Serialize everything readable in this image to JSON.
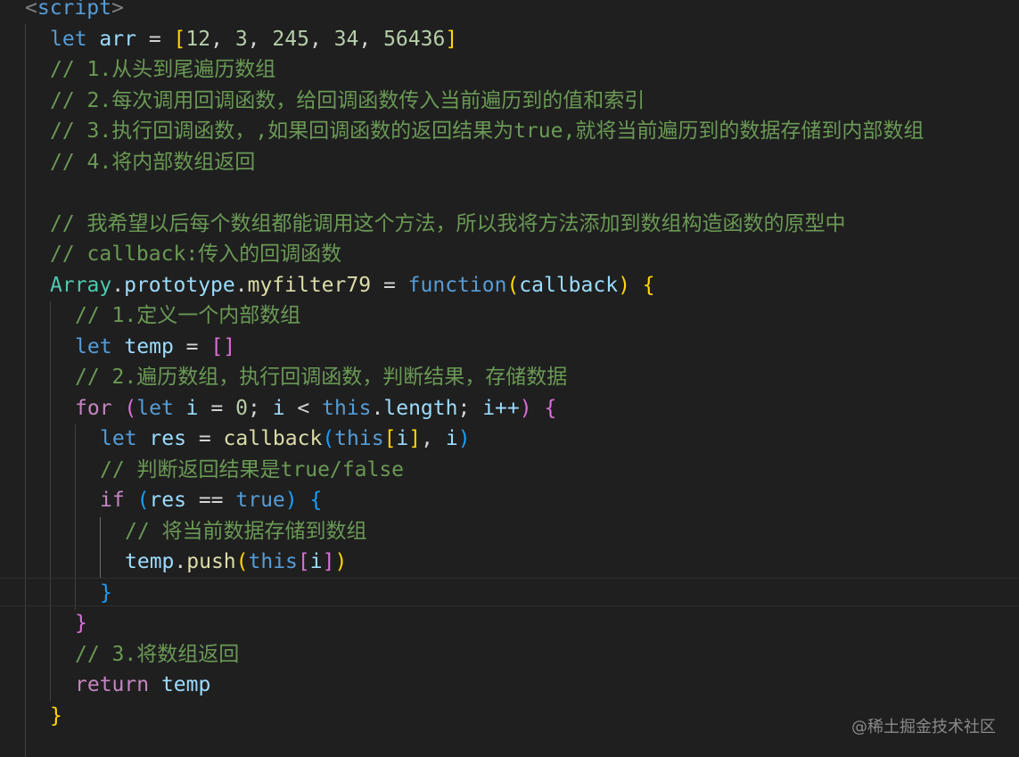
{
  "code": {
    "l1": {
      "lt": "<",
      "name": "script",
      "gt": ">"
    },
    "l2": {
      "kw": "let",
      "var": "arr",
      "eq": "=",
      "open": "[",
      "n1": "12",
      "c1": ",",
      "n2": "3",
      "c2": ",",
      "n3": "245",
      "c3": ",",
      "n4": "34",
      "c4": ",",
      "n5": "56436",
      "close": "]"
    },
    "l3": "// 1.从头到尾遍历数组",
    "l4": "// 2.每次调用回调函数，给回调函数传入当前遍历到的值和索引",
    "l5": "// 3.执行回调函数，,如果回调函数的返回结果为true,就将当前遍历到的数据存储到内部数组",
    "l6": "// 4.将内部数组返回",
    "l8": "// 我希望以后每个数组都能调用这个方法，所以我将方法添加到数组构造函数的原型中",
    "l9": "// callback:传入的回调函数",
    "l10": {
      "cls": "Array",
      "d1": ".",
      "prop1": "prototype",
      "d2": ".",
      "fn": "myfilter79",
      "eq": "=",
      "kw": "function",
      "open": "(",
      "param": "callback",
      "close": ")",
      "brace": "{"
    },
    "l11": "// 1.定义一个内部数组",
    "l12": {
      "kw": "let",
      "var": "temp",
      "eq": "=",
      "arr": "[]"
    },
    "l13": "// 2.遍历数组，执行回调函数，判断结果，存储数据",
    "l14": {
      "kw": "for",
      "open": "(",
      "let": "let",
      "i": "i",
      "eq": "=",
      "zero": "0",
      "semi1": ";",
      "i2": "i",
      "lt": "<",
      "this": "this",
      "dot": ".",
      "length": "length",
      "semi2": ";",
      "i3": "i++",
      "close": ")",
      "brace": "{"
    },
    "l15": {
      "kw": "let",
      "var": "res",
      "eq": "=",
      "fn": "callback",
      "open": "(",
      "this": "this",
      "bo": "[",
      "i": "i",
      "bc": "]",
      "comma": ",",
      "i2": "i",
      "close": ")"
    },
    "l16": "// 判断返回结果是true/false",
    "l17": {
      "kw": "if",
      "open": "(",
      "res": "res",
      "eq": "==",
      "val": "true",
      "close": ")",
      "brace": "{"
    },
    "l18": "// 将当前数据存储到数组",
    "l19": {
      "var": "temp",
      "dot": ".",
      "fn": "push",
      "open": "(",
      "this": "this",
      "bo": "[",
      "i": "i",
      "bc": "]",
      "close": ")"
    },
    "l20": "}",
    "l21": "}",
    "l22": "// 3.将数组返回",
    "l23": {
      "kw": "return",
      "var": "temp"
    },
    "l24": "}"
  },
  "watermark": "@稀土掘金技术社区"
}
